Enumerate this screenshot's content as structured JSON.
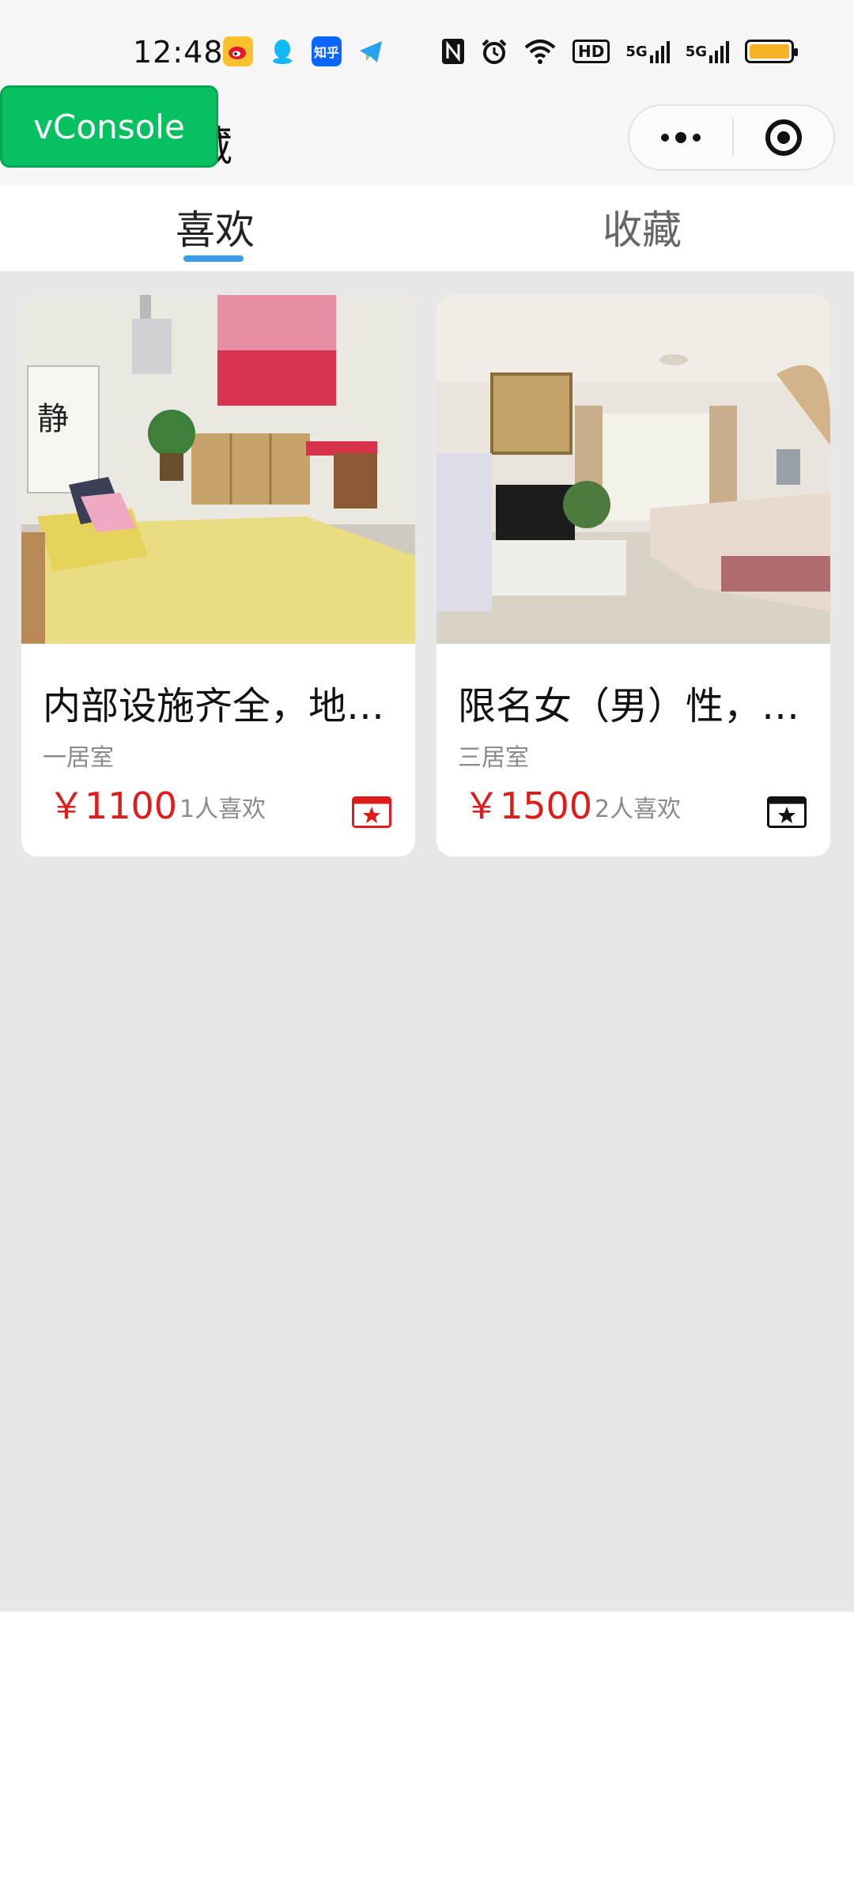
{
  "status": {
    "time": "12:48",
    "notifications": [
      "weibo-icon",
      "qq-icon",
      "zhihu-icon",
      "telegram-icon"
    ],
    "zhihu_label": "知乎",
    "system": [
      "nfc-icon",
      "alarm-icon",
      "wifi-icon",
      "hd-icon",
      "signal-5g-icon",
      "signal-5g-icon",
      "battery-icon"
    ],
    "hd_label": "HD",
    "signal_label": "5G"
  },
  "header": {
    "title": "藏",
    "vconsole_label": "vConsole"
  },
  "tabs": [
    {
      "label": "喜欢",
      "active": true
    },
    {
      "label": "收藏",
      "active": false
    }
  ],
  "listings": [
    {
      "title": "内部设施齐全，地铁口附近",
      "room_type": "一居室",
      "price": "￥1100",
      "likes": "1人喜欢",
      "collected": true
    },
    {
      "title": "限名女（男）性，合租",
      "room_type": "三居室",
      "price": "￥1500",
      "likes": "2人喜欢",
      "collected": false
    }
  ],
  "colors": {
    "accent": "#3b9ce6",
    "price": "#e01b1b",
    "vconsole": "#07c160",
    "battery": "#f5b324"
  }
}
